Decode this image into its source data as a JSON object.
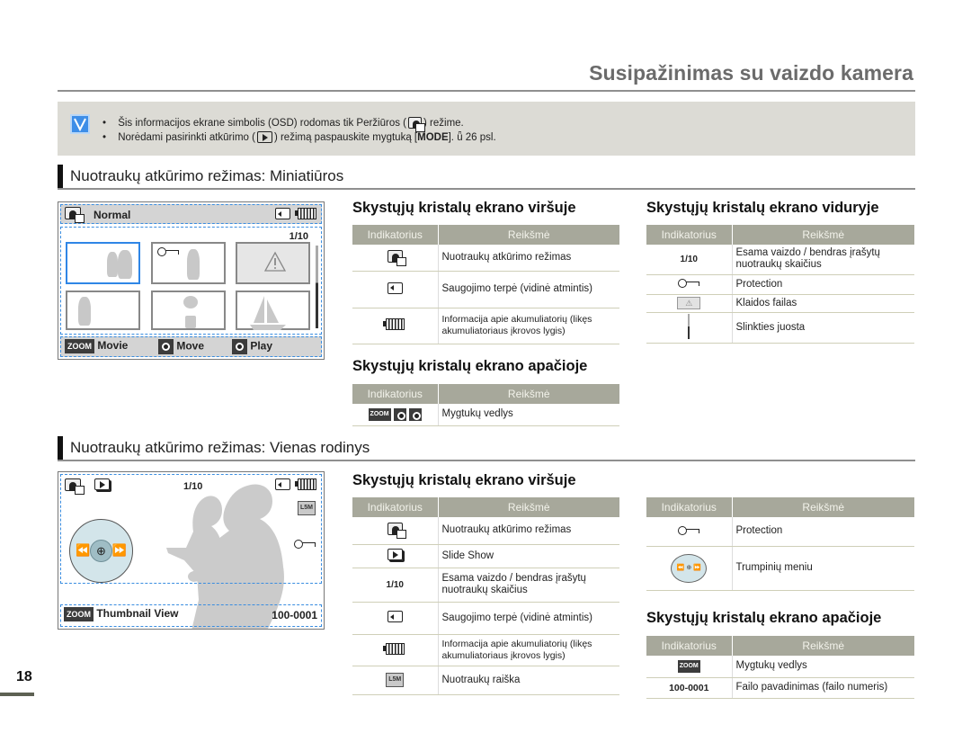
{
  "header": {
    "title": "Susipažinimas su vaizdo kamera"
  },
  "note": {
    "icon": "check-icon",
    "lines": [
      {
        "before": "Šis informacijos ekrane simbolis (OSD) rodomas tik Peržiūros (",
        "icon": "photo-playback-icon",
        "after": ") režime."
      },
      {
        "before": "Norėdami pasirinkti atkūrimo (",
        "icon": "play-icon",
        "after_a": ") režimą paspauskite mygtuką [",
        "bold": "MODE",
        "after_b": "]. ǖ 26 psl."
      }
    ]
  },
  "section1": {
    "title": "Nuotraukų atkūrimo režimas: Miniatiūros",
    "lcd": {
      "mode_label": "Normal",
      "counter": "1/10",
      "thumbnails": [
        {
          "content": "people-silhouette",
          "selected": true
        },
        {
          "content": "protected-person",
          "selected": false
        },
        {
          "content": "error-warning",
          "selected": false
        },
        {
          "content": "soccer-player",
          "selected": false
        },
        {
          "content": "potted-plant",
          "selected": false
        },
        {
          "content": "sailboat",
          "selected": false
        }
      ],
      "guide": [
        {
          "badge": "ZOOM",
          "label": "Movie"
        },
        {
          "badge": "nav-move-icon",
          "label": "Move"
        },
        {
          "badge": "nav-play-icon",
          "label": "Play"
        }
      ]
    },
    "top_table": {
      "title": "Skystųjų kristalų ekrano viršuje",
      "headers": [
        "Indikatorius",
        "Reikšmė"
      ],
      "rows": [
        {
          "icon": "photo-playback-icon",
          "text": "Nuotraukų atkūrimo režimas"
        },
        {
          "icon": "storage-card-icon",
          "text": "Saugojimo terpė (vidinė atmintis)"
        },
        {
          "icon": "battery-icon",
          "text": "Informacija apie akumuliatorių (likęs akumuliatoriaus įkrovos lygis)"
        }
      ]
    },
    "middle_table": {
      "title": "Skystųjų kristalų ekrano viduryje",
      "headers": [
        "Indikatorius",
        "Reikšmė"
      ],
      "rows": [
        {
          "indicator": "1/10",
          "text": "Esama vaizdo / bendras įrašytų nuotraukų skaičius"
        },
        {
          "icon": "key-icon",
          "text": "Protection"
        },
        {
          "icon": "warning-icon",
          "text": "Klaidos failas"
        },
        {
          "icon": "scrollbar-icon",
          "text": "Slinkties juosta"
        }
      ]
    },
    "bottom_table": {
      "title": "Skystųjų kristalų ekrano apačioje",
      "headers": [
        "Indikatorius",
        "Reikšmė"
      ],
      "rows": [
        {
          "indicator": "ZOOM",
          "text": "Mygtukų vedlys"
        }
      ]
    }
  },
  "section2": {
    "title": "Nuotraukų atkūrimo režimas: Vienas rodinys",
    "lcd": {
      "counter": "1/10",
      "guide_badge": "ZOOM",
      "guide_label": "Thumbnail View",
      "file_number": "100-0001"
    },
    "top_table": {
      "title": "Skystųjų kristalų ekrano viršuje",
      "headers": [
        "Indikatorius",
        "Reikšmė"
      ],
      "rows": [
        {
          "icon": "photo-playback-icon",
          "text": "Nuotraukų atkūrimo režimas"
        },
        {
          "icon": "slideshow-icon",
          "text": "Slide Show"
        },
        {
          "indicator": "1/10",
          "text": "Esama vaizdo / bendras įrašytų nuotraukų skaičius"
        },
        {
          "icon": "storage-card-icon",
          "text": "Saugojimo terpė (vidinė atmintis)"
        },
        {
          "icon": "battery-icon",
          "text": "Informacija apie akumuliatorių (likęs akumuliatoriaus įkrovos lygis)"
        },
        {
          "icon": "resolution-icon",
          "text": "Nuotraukų raiška"
        }
      ]
    },
    "middle_table": {
      "headers": [
        "Indikatorius",
        "Reikšmė"
      ],
      "rows": [
        {
          "icon": "key-icon",
          "text": "Protection"
        },
        {
          "icon": "shortcut-dial-icon",
          "text": "Trumpinių meniu"
        }
      ]
    },
    "bottom_table": {
      "title": "Skystųjų kristalų ekrano apačioje",
      "headers": [
        "Indikatorius",
        "Reikšmė"
      ],
      "rows": [
        {
          "indicator": "ZOOM",
          "text": "Mygtukų vedlys"
        },
        {
          "indicator": "100-0001",
          "text": "Failo pavadinimas (failo numeris)"
        }
      ]
    }
  },
  "footer": {
    "page_number": "18"
  }
}
